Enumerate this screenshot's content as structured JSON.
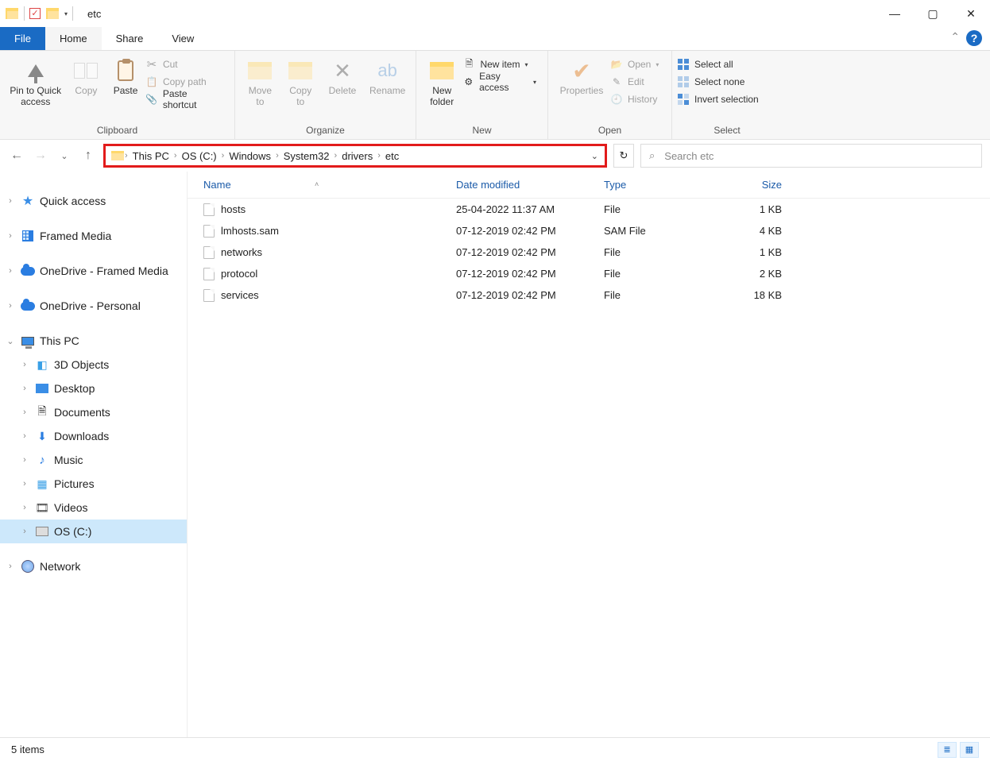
{
  "window": {
    "title": "etc"
  },
  "tabs": {
    "file": "File",
    "home": "Home",
    "share": "Share",
    "view": "View"
  },
  "ribbon": {
    "clipboard": {
      "label": "Clipboard",
      "pin": "Pin to Quick\naccess",
      "copy": "Copy",
      "paste": "Paste",
      "cut": "Cut",
      "copy_path": "Copy path",
      "paste_shortcut": "Paste shortcut"
    },
    "organize": {
      "label": "Organize",
      "move_to": "Move\nto",
      "copy_to": "Copy\nto",
      "delete": "Delete",
      "rename": "Rename"
    },
    "new": {
      "label": "New",
      "new_folder": "New\nfolder",
      "new_item": "New item",
      "easy_access": "Easy access"
    },
    "open": {
      "label": "Open",
      "properties": "Properties",
      "open": "Open",
      "edit": "Edit",
      "history": "History"
    },
    "select": {
      "label": "Select",
      "select_all": "Select all",
      "select_none": "Select none",
      "invert": "Invert selection"
    }
  },
  "breadcrumbs": [
    "This PC",
    "OS (C:)",
    "Windows",
    "System32",
    "drivers",
    "etc"
  ],
  "search": {
    "placeholder": "Search etc"
  },
  "navpane": {
    "quick_access": "Quick access",
    "framed_media": "Framed Media",
    "onedrive_fm": "OneDrive - Framed Media",
    "onedrive_personal": "OneDrive - Personal",
    "this_pc": "This PC",
    "children": [
      "3D Objects",
      "Desktop",
      "Documents",
      "Downloads",
      "Music",
      "Pictures",
      "Videos",
      "OS (C:)"
    ],
    "network": "Network"
  },
  "columns": {
    "name": "Name",
    "date": "Date modified",
    "type": "Type",
    "size": "Size"
  },
  "files": [
    {
      "name": "hosts",
      "date": "25-04-2022 11:37 AM",
      "type": "File",
      "size": "1 KB"
    },
    {
      "name": "lmhosts.sam",
      "date": "07-12-2019 02:42 PM",
      "type": "SAM File",
      "size": "4 KB"
    },
    {
      "name": "networks",
      "date": "07-12-2019 02:42 PM",
      "type": "File",
      "size": "1 KB"
    },
    {
      "name": "protocol",
      "date": "07-12-2019 02:42 PM",
      "type": "File",
      "size": "2 KB"
    },
    {
      "name": "services",
      "date": "07-12-2019 02:42 PM",
      "type": "File",
      "size": "18 KB"
    }
  ],
  "status": {
    "count": "5 items"
  }
}
